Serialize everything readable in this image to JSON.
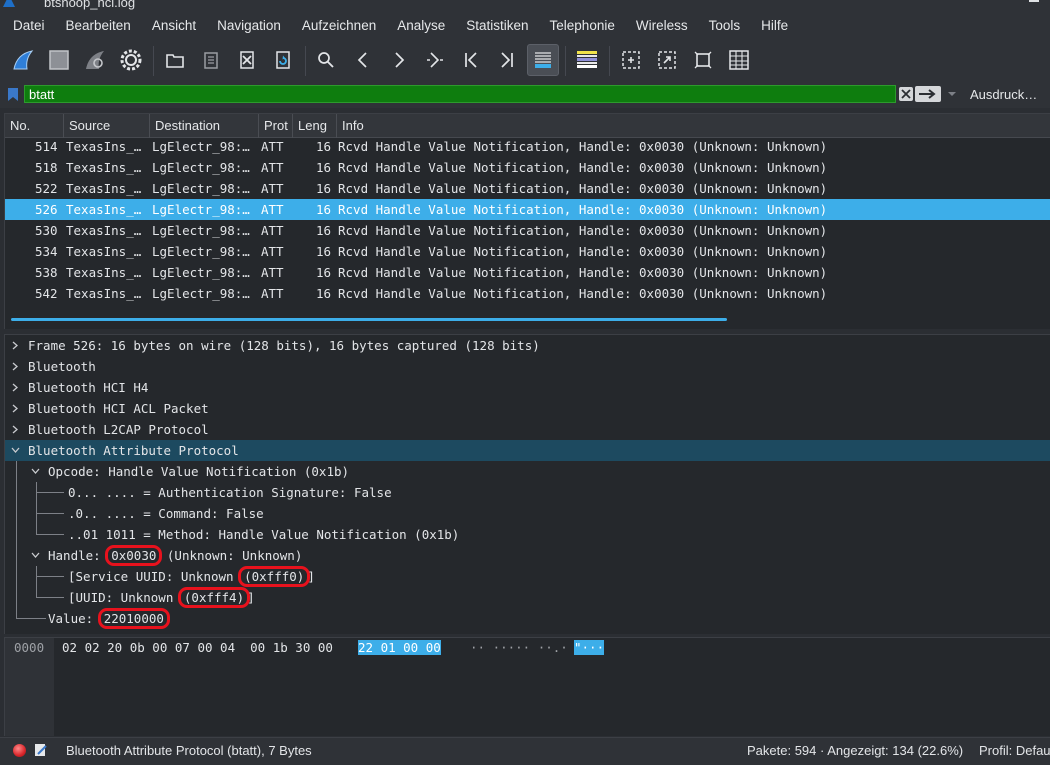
{
  "window": {
    "title": "btsnoop_hci.log"
  },
  "menu": [
    "Datei",
    "Bearbeiten",
    "Ansicht",
    "Navigation",
    "Aufzeichnen",
    "Analyse",
    "Statistiken",
    "Telephonie",
    "Wireless",
    "Tools",
    "Hilfe"
  ],
  "toolbar": {
    "icons": [
      "shark-fin-start-icon",
      "stop-square-icon",
      "shark-fin-restart-icon",
      "gear-options-icon",
      "open-folder-icon",
      "file-archive-icon",
      "close-file-icon",
      "reload-icon",
      "search-icon",
      "back-arrow-icon",
      "forward-arrow-icon",
      "go-to-packet-icon",
      "first-packet-icon",
      "last-packet-icon",
      "autoscroll-icon",
      "colorize-icon",
      "zoom-in-icon",
      "zoom-out-icon",
      "normal-size-icon",
      "resize-columns-icon"
    ]
  },
  "filter": {
    "value": "btatt",
    "expression_label": "Ausdruck…",
    "bg_color": "#0e7d0e"
  },
  "packet_list": {
    "columns": [
      "No.",
      "Source",
      "Destination",
      "Prot",
      "Leng",
      "Info"
    ],
    "rows": [
      {
        "no": "514",
        "source": "TexasIns_…",
        "destination": "LgElectr_98:…",
        "protocol": "ATT",
        "length": "16",
        "info": "Rcvd Handle Value Notification, Handle: 0x0030 (Unknown: Unknown)"
      },
      {
        "no": "518",
        "source": "TexasIns_…",
        "destination": "LgElectr_98:…",
        "protocol": "ATT",
        "length": "16",
        "info": "Rcvd Handle Value Notification, Handle: 0x0030 (Unknown: Unknown)"
      },
      {
        "no": "522",
        "source": "TexasIns_…",
        "destination": "LgElectr_98:…",
        "protocol": "ATT",
        "length": "16",
        "info": "Rcvd Handle Value Notification, Handle: 0x0030 (Unknown: Unknown)"
      },
      {
        "no": "526",
        "source": "TexasIns_…",
        "destination": "LgElectr_98:…",
        "protocol": "ATT",
        "length": "16",
        "info": "Rcvd Handle Value Notification, Handle: 0x0030 (Unknown: Unknown)"
      },
      {
        "no": "530",
        "source": "TexasIns_…",
        "destination": "LgElectr_98:…",
        "protocol": "ATT",
        "length": "16",
        "info": "Rcvd Handle Value Notification, Handle: 0x0030 (Unknown: Unknown)"
      },
      {
        "no": "534",
        "source": "TexasIns_…",
        "destination": "LgElectr_98:…",
        "protocol": "ATT",
        "length": "16",
        "info": "Rcvd Handle Value Notification, Handle: 0x0030 (Unknown: Unknown)"
      },
      {
        "no": "538",
        "source": "TexasIns_…",
        "destination": "LgElectr_98:…",
        "protocol": "ATT",
        "length": "16",
        "info": "Rcvd Handle Value Notification, Handle: 0x0030 (Unknown: Unknown)"
      },
      {
        "no": "542",
        "source": "TexasIns_…",
        "destination": "LgElectr_98:…",
        "protocol": "ATT",
        "length": "16",
        "info": "Rcvd Handle Value Notification, Handle: 0x0030 (Unknown: Unknown)"
      }
    ],
    "selected_no": "526"
  },
  "details": {
    "frame": "Frame 526: 16 bytes on wire (128 bits), 16 bytes captured (128 bits)",
    "bluetooth": "Bluetooth",
    "hci_h4": "Bluetooth HCI H4",
    "hci_acl": "Bluetooth HCI ACL Packet",
    "l2cap": "Bluetooth L2CAP Protocol",
    "att": "Bluetooth Attribute Protocol",
    "opcode": "Opcode: Handle Value Notification (0x1b)",
    "auth_sig": "0... .... = Authentication Signature: False",
    "command": ".0.. .... = Command: False",
    "method": "..01 1011 = Method: Handle Value Notification (0x1b)",
    "handle_label": "Handle: ",
    "handle_value": "0x0030",
    "handle_suffix": " (Unknown: Unknown)",
    "service_uuid_label": "[Service UUID: Unknown ",
    "service_uuid_value": "(0xfff0)",
    "service_uuid_close": "]",
    "uuid_label": "[UUID: Unknown ",
    "uuid_value": "(0xfff4)",
    "uuid_close": "]",
    "value_label": "Value: ",
    "value_value": "22010000"
  },
  "bytes": {
    "offset": "0000",
    "hex_plain": "02 02 20 0b 00 07 00 04  00 1b 30 00 ",
    "hex_selected": "22 01 00 00",
    "ascii_plain": "·· ····· ··.·",
    "ascii_selected": "\"···"
  },
  "status": {
    "text": "Bluetooth Attribute Protocol (btatt), 7 Bytes",
    "counts": "Pakete: 594 · Angezeigt: 134 (22.6%)",
    "profile": "Profil: Default"
  },
  "colors": {
    "accent": "#3daee9",
    "annotation": "#e8121d",
    "background": "#2b2e33"
  }
}
